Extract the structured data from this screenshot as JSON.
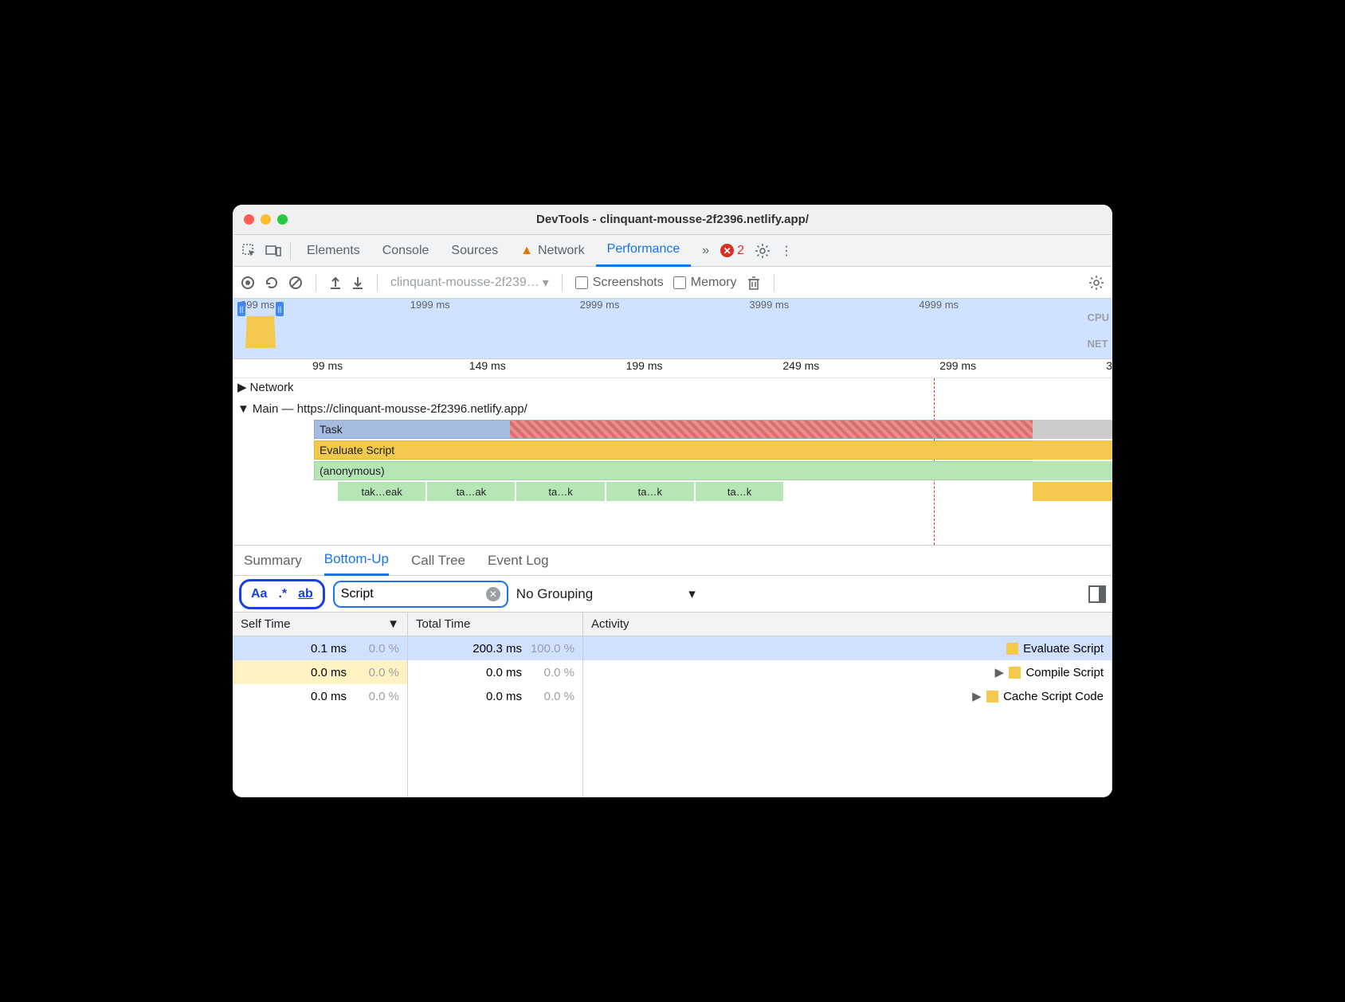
{
  "window": {
    "title": "DevTools - clinquant-mousse-2f2396.netlify.app/"
  },
  "tabs": {
    "elements": "Elements",
    "console": "Console",
    "sources": "Sources",
    "network": "Network",
    "performance": "Performance",
    "more": "»",
    "error_count": "2"
  },
  "toolbar": {
    "profile_name": "clinquant-mousse-2f239…",
    "screenshots": "Screenshots",
    "memory": "Memory"
  },
  "overview": {
    "ticks": [
      "999 ms",
      "1999 ms",
      "2999 ms",
      "3999 ms",
      "4999 ms"
    ],
    "label_cpu": "CPU",
    "label_net": "NET"
  },
  "ruler": [
    "99 ms",
    "149 ms",
    "199 ms",
    "249 ms",
    "299 ms",
    "3"
  ],
  "flame": {
    "network_label": "Network",
    "main_label": "Main — https://clinquant-mousse-2f2396.netlify.app/",
    "task": "Task",
    "eval": "Evaluate Script",
    "anon": "(anonymous)",
    "calls": [
      "tak…eak",
      "ta…ak",
      "ta…k",
      "ta…k",
      "ta…k"
    ]
  },
  "bottom_tabs": {
    "summary": "Summary",
    "bottomup": "Bottom-Up",
    "calltree": "Call Tree",
    "eventlog": "Event Log"
  },
  "filter": {
    "case": "Aa",
    "regex": ".*",
    "word": "ab",
    "value": "Script",
    "grouping": "No Grouping"
  },
  "table": {
    "headers": {
      "self": "Self Time",
      "total": "Total Time",
      "activity": "Activity"
    },
    "rows": [
      {
        "self_ms": "0.1 ms",
        "self_pct": "0.0 %",
        "total_ms": "200.3 ms",
        "total_pct": "100.0 %",
        "expander": "",
        "activity": "Evaluate Script"
      },
      {
        "self_ms": "0.0 ms",
        "self_pct": "0.0 %",
        "total_ms": "0.0 ms",
        "total_pct": "0.0 %",
        "expander": "▶",
        "activity": "Compile Script"
      },
      {
        "self_ms": "0.0 ms",
        "self_pct": "0.0 %",
        "total_ms": "0.0 ms",
        "total_pct": "0.0 %",
        "expander": "▶",
        "activity": "Cache Script Code"
      }
    ]
  }
}
